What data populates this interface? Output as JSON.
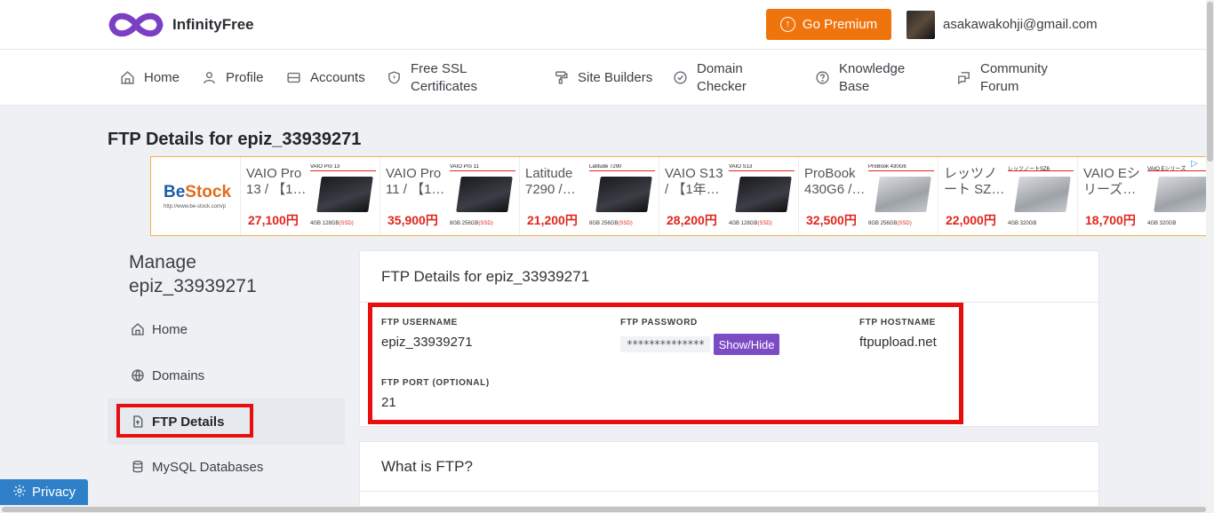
{
  "brand": {
    "name": "InfinityFree",
    "logo_color": "#7b3fc4"
  },
  "header": {
    "premium_label": "Go Premium",
    "premium_color": "#f0740d",
    "user_email": "asakawakohji@gmail.com"
  },
  "nav": {
    "items": [
      {
        "label": "Home",
        "icon": "home-icon"
      },
      {
        "label": "Profile",
        "icon": "user-icon"
      },
      {
        "label": "Accounts",
        "icon": "server-icon"
      },
      {
        "label": "Free SSL Certificates",
        "icon": "shield-icon"
      },
      {
        "label": "Site Builders",
        "icon": "paint-roller-icon"
      },
      {
        "label": "Domain Checker",
        "icon": "check-circle-icon"
      },
      {
        "label": "Knowledge Base",
        "icon": "question-icon"
      },
      {
        "label": "Community Forum",
        "icon": "chat-icon"
      }
    ]
  },
  "page": {
    "title": "FTP Details for epiz_33939271"
  },
  "ad": {
    "logo_text_main": "Be",
    "logo_text_accent": "Stock",
    "logo_url": "http://www.be-stock.com/p",
    "products": [
      {
        "name": "VAIO Pro 13 / 【1…",
        "model": "VAIO Pro 13",
        "price": "27,100円",
        "specs": "4GB 128GB",
        "ssd": "(SSD)"
      },
      {
        "name": "VAIO Pro 11 / 【1…",
        "model": "VAIO Pro 11",
        "price": "35,900円",
        "specs": "8GB 256GB",
        "ssd": "(SSD)"
      },
      {
        "name": "Latitude 7290 /…",
        "model": "Latitude 7290",
        "price": "21,200円",
        "specs": "8GB 256GB",
        "ssd": "(SSD)"
      },
      {
        "name": "VAIO S13 / 【1年…",
        "model": "VAIO S13",
        "price": "28,200円",
        "specs": "4GB 128GB",
        "ssd": "(SSD)"
      },
      {
        "name": "ProBook 430G6 /…",
        "model": "ProBook 430G6",
        "price": "32,500円",
        "specs": "8GB 256GB",
        "ssd": "(SSD)"
      },
      {
        "name": "レッツノート SZ…",
        "model": "レッツノートSZ6",
        "price": "22,000円",
        "specs": "4GB 320GB",
        "ssd": ""
      },
      {
        "name": "VAIO Eシリーズ…",
        "model": "VAIO Eシリーズ",
        "price": "18,700円",
        "specs": "4GB 320GB",
        "ssd": ""
      }
    ]
  },
  "sidebar": {
    "title": "Manage epiz_33939271",
    "items": [
      {
        "label": "Home",
        "icon": "home-icon",
        "active": false
      },
      {
        "label": "Domains",
        "icon": "globe-icon",
        "active": false
      },
      {
        "label": "FTP Details",
        "icon": "file-upload-icon",
        "active": true
      },
      {
        "label": "MySQL Databases",
        "icon": "database-icon",
        "active": false
      }
    ]
  },
  "ftp_card": {
    "title": "FTP Details for epiz_33939271",
    "username_label": "FTP USERNAME",
    "username": "epiz_33939271",
    "password_label": "FTP PASSWORD",
    "password_mask": "**************",
    "show_hide_label": "Show/Hide",
    "hostname_label": "FTP HOSTNAME",
    "hostname": "ftpupload.net",
    "port_label": "FTP PORT (OPTIONAL)",
    "port": "21"
  },
  "info_card": {
    "title": "What is FTP?"
  },
  "privacy": {
    "label": "Privacy"
  },
  "highlight_color": "#e80e0e",
  "accent_purple": "#7b4cc4"
}
